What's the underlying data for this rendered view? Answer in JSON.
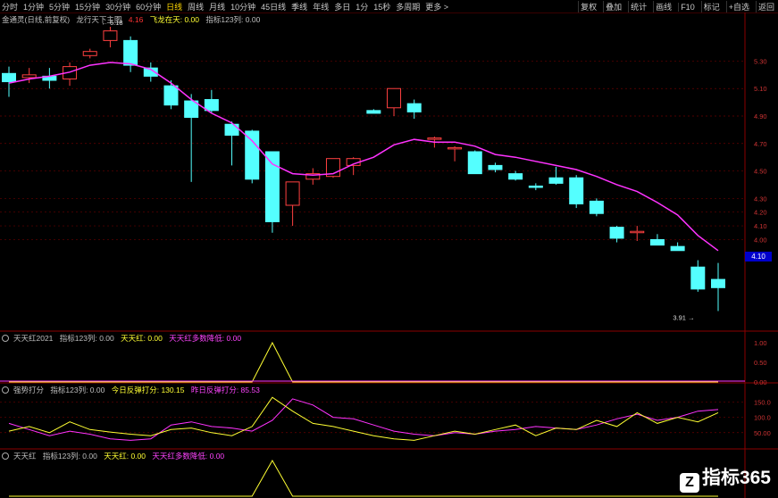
{
  "toolbar": {
    "tabs": [
      "分时",
      "1分钟",
      "5分钟",
      "15分钟",
      "30分钟",
      "60分钟",
      "日线",
      "周线",
      "月线",
      "10分钟",
      "45日线",
      "季线",
      "年线",
      "多日",
      "1分",
      "15秒",
      "多周期",
      "更多 >"
    ],
    "active_tab": "日线",
    "tools": [
      "复权",
      "叠加",
      "统计",
      "画线",
      "F10",
      "标记",
      "+自选",
      "返回"
    ]
  },
  "main_header": {
    "title": "金通灵(日线,前复权)",
    "indicator": "龙行天下主图",
    "v1": "4.16",
    "label2": "飞龙在天: 0.00",
    "label3": "指标123列: 0.00"
  },
  "annotations": {
    "high": "6.18",
    "low": "3.91"
  },
  "price_tag": "4.10",
  "price_axis": [
    "5.30",
    "5.10",
    "4.90",
    "4.70",
    "4.50",
    "4.30",
    "4.20",
    "4.10",
    "4.00"
  ],
  "panel1": {
    "name": "天天红2021",
    "f1": "指标123列: 0.00",
    "f2": "天天红: 0.00",
    "f3": "天天红多数降低: 0.00",
    "axis": [
      "1.00",
      "0.50",
      "0.00"
    ]
  },
  "panel2": {
    "name": "强势打分",
    "f1": "指标123列: 0.00",
    "f2": "今日反弹打分: 130.15",
    "f3": "昨日反弹打分: 85.53",
    "axis": [
      "150.0",
      "100.0",
      "50.00"
    ]
  },
  "panel3": {
    "name": "天天红",
    "f1": "指标123列: 0.00",
    "f2": "天天红: 0.00",
    "f3": "天天红多数降低: 0.00"
  },
  "watermark": "指标365",
  "colors": {
    "up": "#ff4040",
    "down": "#54ffff",
    "ma": "#ff33ff",
    "grid": "#6a0000",
    "yellow": "#ffff33"
  },
  "chart_data": {
    "type": "candlestick",
    "candles": [
      {
        "o": 5.21,
        "h": 5.26,
        "l": 5.04,
        "c": 5.15
      },
      {
        "o": 5.18,
        "h": 5.25,
        "l": 5.14,
        "c": 5.2
      },
      {
        "o": 5.19,
        "h": 5.25,
        "l": 5.1,
        "c": 5.16
      },
      {
        "o": 5.17,
        "h": 5.29,
        "l": 5.12,
        "c": 5.26
      },
      {
        "o": 5.34,
        "h": 5.39,
        "l": 5.32,
        "c": 5.37
      },
      {
        "o": 5.45,
        "h": 5.55,
        "l": 5.4,
        "c": 5.52
      },
      {
        "o": 5.45,
        "h": 5.48,
        "l": 5.22,
        "c": 5.27
      },
      {
        "o": 5.25,
        "h": 5.29,
        "l": 5.15,
        "c": 5.19
      },
      {
        "o": 5.12,
        "h": 5.16,
        "l": 4.95,
        "c": 4.98
      },
      {
        "o": 5.01,
        "h": 5.06,
        "l": 4.42,
        "c": 4.89
      },
      {
        "o": 5.02,
        "h": 5.09,
        "l": 4.92,
        "c": 4.94
      },
      {
        "o": 4.84,
        "h": 4.86,
        "l": 4.54,
        "c": 4.76
      },
      {
        "o": 4.79,
        "h": 4.8,
        "l": 4.41,
        "c": 4.44
      },
      {
        "o": 4.64,
        "h": 4.64,
        "l": 4.05,
        "c": 4.13
      },
      {
        "o": 4.25,
        "h": 4.34,
        "l": 4.1,
        "c": 4.42
      },
      {
        "o": 4.44,
        "h": 4.52,
        "l": 4.4,
        "c": 4.48
      },
      {
        "o": 4.46,
        "h": 4.58,
        "l": 4.45,
        "c": 4.59
      },
      {
        "o": 4.54,
        "h": 4.6,
        "l": 4.47,
        "c": 4.59
      },
      {
        "o": 4.94,
        "h": 4.95,
        "l": 4.94,
        "c": 4.92
      },
      {
        "o": 4.96,
        "h": 5.09,
        "l": 4.9,
        "c": 5.1
      },
      {
        "o": 4.99,
        "h": 5.02,
        "l": 4.88,
        "c": 4.93
      },
      {
        "o": 4.74,
        "h": 4.75,
        "l": 4.67,
        "c": 4.74
      },
      {
        "o": 4.67,
        "h": 4.68,
        "l": 4.57,
        "c": 4.67
      },
      {
        "o": 4.64,
        "h": 4.65,
        "l": 4.51,
        "c": 4.48
      },
      {
        "o": 4.54,
        "h": 4.56,
        "l": 4.49,
        "c": 4.51
      },
      {
        "o": 4.48,
        "h": 4.5,
        "l": 4.43,
        "c": 4.44
      },
      {
        "o": 4.39,
        "h": 4.41,
        "l": 4.36,
        "c": 4.38
      },
      {
        "o": 4.45,
        "h": 4.53,
        "l": 4.4,
        "c": 4.41
      },
      {
        "o": 4.45,
        "h": 4.47,
        "l": 4.23,
        "c": 4.26
      },
      {
        "o": 4.28,
        "h": 4.3,
        "l": 4.17,
        "c": 4.19
      },
      {
        "o": 4.09,
        "h": 4.1,
        "l": 3.98,
        "c": 4.01
      },
      {
        "o": 4.06,
        "h": 4.1,
        "l": 3.99,
        "c": 4.06
      },
      {
        "o": 4.0,
        "h": 4.04,
        "l": 3.98,
        "c": 3.96
      },
      {
        "o": 3.95,
        "h": 3.98,
        "l": 3.93,
        "c": 3.92
      },
      {
        "o": 3.8,
        "h": 3.85,
        "l": 3.62,
        "c": 3.64
      },
      {
        "o": 3.71,
        "h": 3.83,
        "l": 3.48,
        "c": 3.65
      }
    ],
    "ma": [
      5.14,
      5.17,
      5.19,
      5.22,
      5.27,
      5.29,
      5.28,
      5.24,
      5.14,
      5.02,
      4.92,
      4.85,
      4.72,
      4.55,
      4.48,
      4.47,
      4.48,
      4.55,
      4.6,
      4.69,
      4.73,
      4.71,
      4.71,
      4.68,
      4.62,
      4.6,
      4.57,
      4.54,
      4.51,
      4.46,
      4.4,
      4.35,
      4.27,
      4.18,
      4.03,
      3.92
    ],
    "panel1_series": [
      0,
      0,
      0,
      0,
      0,
      0,
      0,
      0,
      0,
      0,
      0,
      0,
      0,
      1,
      0,
      0,
      0,
      0,
      0,
      0,
      0,
      0,
      0,
      0,
      0,
      0,
      0,
      0,
      0,
      0,
      0,
      0,
      0,
      0,
      0,
      0
    ],
    "panel2_yellow": [
      55,
      70,
      50,
      85,
      60,
      52,
      45,
      40,
      60,
      65,
      50,
      40,
      70,
      165,
      120,
      80,
      70,
      55,
      40,
      30,
      25,
      40,
      55,
      45,
      60,
      75,
      40,
      65,
      60,
      90,
      70,
      115,
      80,
      100,
      85,
      115
    ],
    "panel2_magenta": [
      80,
      60,
      40,
      55,
      45,
      30,
      25,
      30,
      75,
      85,
      70,
      65,
      55,
      90,
      160,
      140,
      100,
      95,
      75,
      55,
      45,
      40,
      50,
      45,
      55,
      60,
      70,
      65,
      60,
      75,
      95,
      110,
      90,
      100,
      120,
      125
    ]
  }
}
